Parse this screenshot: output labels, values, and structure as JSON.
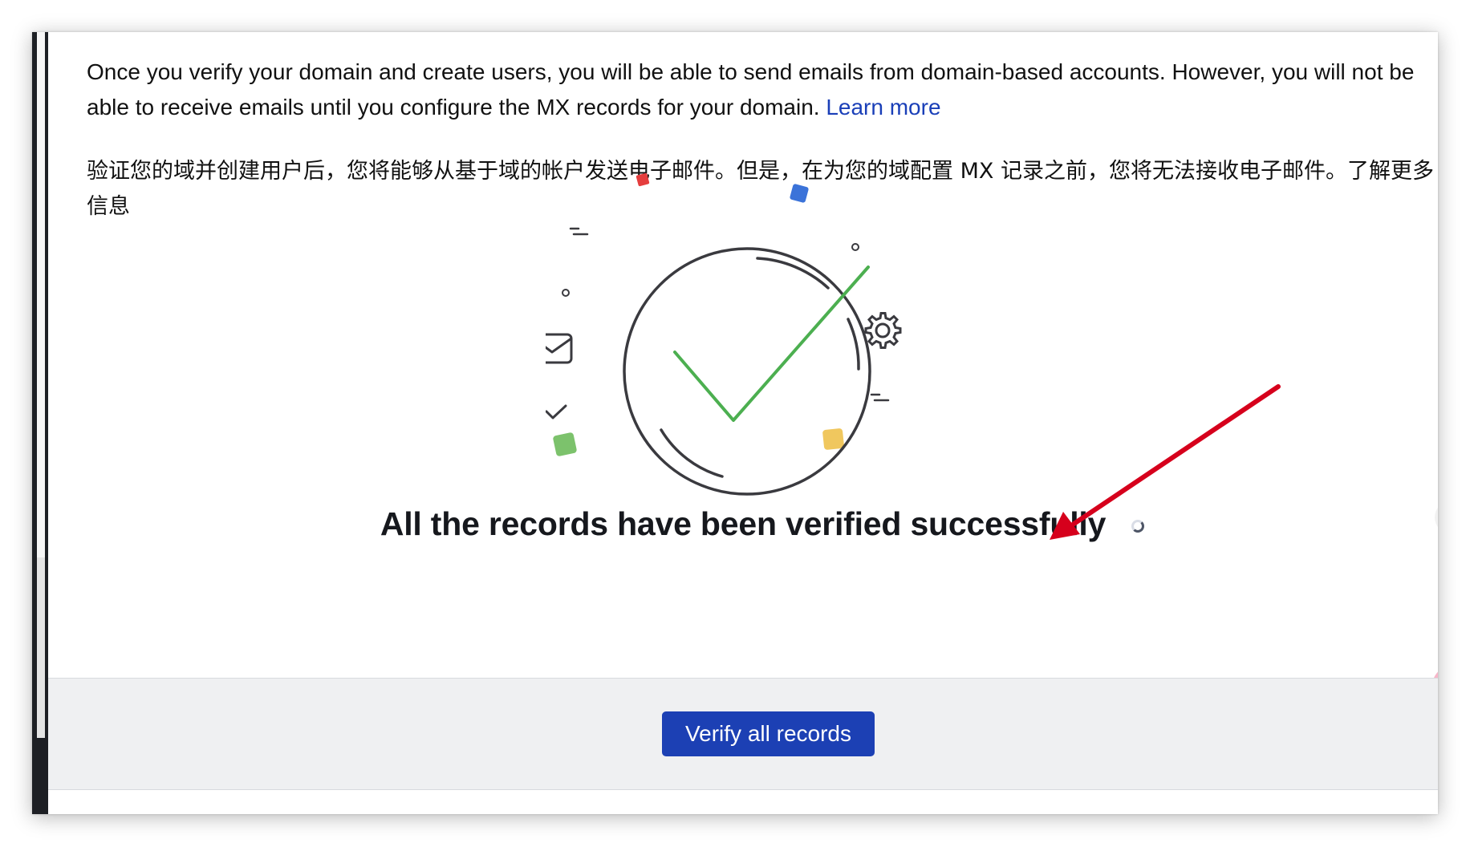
{
  "notice": {
    "en_text": "Once you verify your domain and create users, you will be able to send emails from domain-based accounts. However, you will not be able to receive emails until you configure the MX records for your domain.",
    "en_link": "Learn more",
    "zh_text": "验证您的域并创建用户后，您将能够从基于域的帐户发送电子邮件。但是，在为您的域配置 MX 记录之前，您将无法接收电子邮件。了解更多信息"
  },
  "status": {
    "message": "All the records have been verified successfully"
  },
  "footer": {
    "verify_button": "Verify all records"
  },
  "icons": {
    "illustration": "success-check-illustration",
    "mail": "mail-icon",
    "gear": "gear-icon",
    "check": "check-icon",
    "spinner": "loading-spinner-icon",
    "annotation": "red-arrow-annotation"
  },
  "colors": {
    "accent": "#1c40b4",
    "link": "#1a3fb8",
    "check_green": "#4caf50",
    "arrow_red": "#d6001c",
    "confetti_red": "#e53e3e",
    "confetti_blue": "#3b73d9",
    "confetti_green": "#7cc26c",
    "confetti_yellow": "#f0c75e"
  }
}
